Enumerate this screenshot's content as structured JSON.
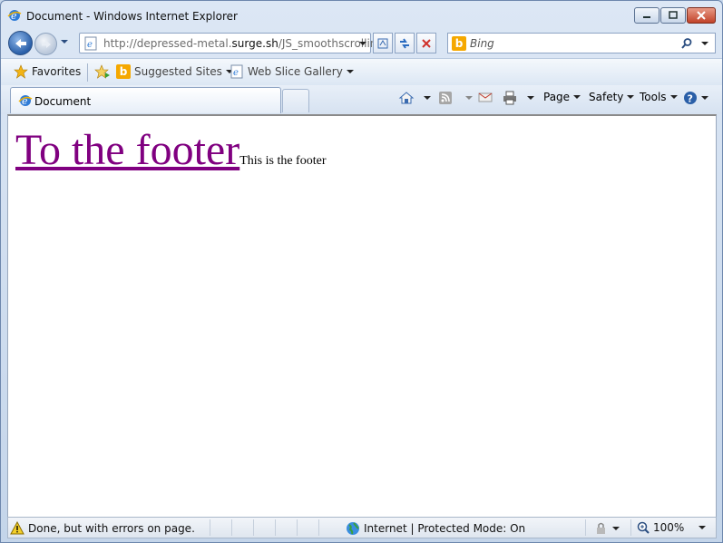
{
  "window": {
    "title": "Document - Windows Internet Explorer"
  },
  "address_bar": {
    "url_prefix": "http://depressed-metal.",
    "url_domain": "surge.sh",
    "url_suffix": "/JS_smoothscrolling"
  },
  "search": {
    "placeholder": "Bing"
  },
  "favorites_bar": {
    "favorites_label": "Favorites",
    "suggested_sites_label": "Suggested Sites",
    "web_slice_gallery_label": "Web Slice Gallery"
  },
  "tabs": [
    {
      "label": "Document"
    }
  ],
  "command_bar": {
    "page_label": "Page",
    "safety_label": "Safety",
    "tools_label": "Tools"
  },
  "page": {
    "link_text": "To the footer",
    "footer_text": "This is the footer"
  },
  "status_bar": {
    "status_text": "Done, but with errors on page.",
    "zone_text": "Internet | Protected Mode: On",
    "zoom_text": "100%"
  },
  "colors": {
    "visited_link": "#800080",
    "accent": "#2a5fa8"
  }
}
